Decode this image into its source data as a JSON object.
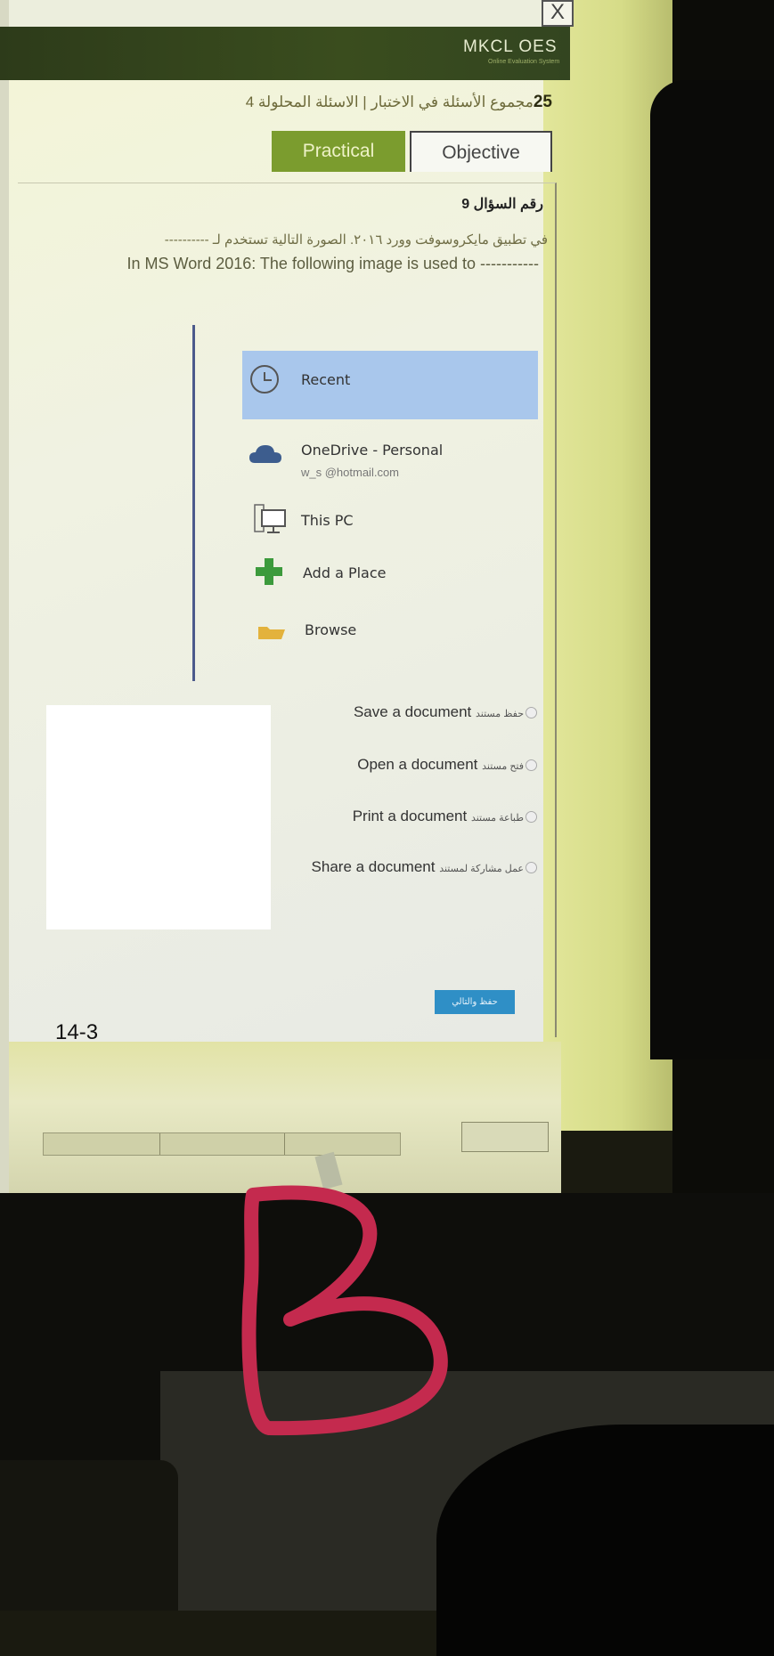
{
  "window": {
    "close_glyph": "X"
  },
  "header": {
    "brand": "MKCL OES",
    "brand_sub": "Online Evaluation System"
  },
  "exam": {
    "group_number": "25",
    "group_line": "مجموع الأسئلة في الاختبار | الاسئلة المحلولة 4",
    "tabs": [
      {
        "label": "Practical",
        "active": true
      },
      {
        "label": "Objective",
        "active": false
      }
    ]
  },
  "question": {
    "number_label": "رقم السؤال 9",
    "text_ar": "في تطبيق مايكروسوفت وورد ٢٠١٦. الصورة التالية تستخدم لـ ---------------",
    "text_en": "In MS Word 2016: The following image is used to -----------"
  },
  "backstage": {
    "items": [
      {
        "label": "Recent",
        "icon": "clock-icon",
        "selected": true
      },
      {
        "label": "OneDrive - Personal",
        "sub": "w_s    @hotmail.com",
        "icon": "cloud-icon"
      },
      {
        "label": "This PC",
        "icon": "computer-icon"
      },
      {
        "label": "Add a Place",
        "icon": "plus-icon"
      },
      {
        "label": "Browse",
        "icon": "folder-icon"
      }
    ]
  },
  "options": [
    {
      "en": "Save a document",
      "ar": "حفظ مستند"
    },
    {
      "en": "Open a document",
      "ar": "فتح مستند"
    },
    {
      "en": "Print a document",
      "ar": "طباعة مستند"
    },
    {
      "en": "Share a document",
      "ar": "عمل مشاركة لمستند"
    }
  ],
  "actions": {
    "submit_label": "حفظ والتالي"
  },
  "annotation": {
    "label": "14-3"
  }
}
